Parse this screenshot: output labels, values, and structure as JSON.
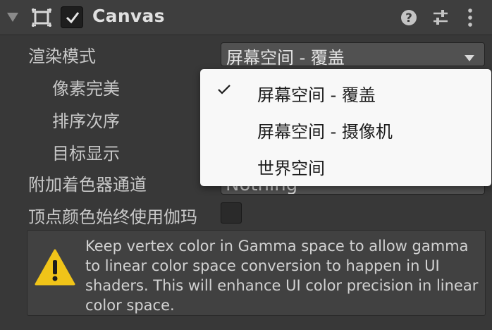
{
  "component": {
    "title": "Canvas",
    "enabled": true,
    "icons": [
      "foldout-triangle-icon",
      "canvas-component-icon",
      "help-icon",
      "preset-icon",
      "kebab-menu-icon"
    ]
  },
  "properties": {
    "render_mode": {
      "label": "渲染模式",
      "value": "屏幕空间 - 覆盖"
    },
    "pixel_perfect": {
      "label": "像素完美"
    },
    "sort_order": {
      "label": "排序次序"
    },
    "target_display": {
      "label": "目标显示"
    },
    "additional_shader_channels": {
      "label": "附加着色器通道",
      "value": "Nothing"
    },
    "vertex_color_gamma": {
      "label": "顶点颜色始终使用伽玛",
      "checked": false
    }
  },
  "helpbox": {
    "icon": "warning-icon",
    "text": "Keep vertex color in Gamma space to allow gamma to linear color space conversion to happen in UI shaders. This will enhance UI color precision in linear color space."
  },
  "dropdown": {
    "options": [
      {
        "label": "屏幕空间 - 覆盖",
        "selected": true
      },
      {
        "label": "屏幕空间 - 摄像机",
        "selected": false
      },
      {
        "label": "世界空间",
        "selected": false
      }
    ]
  },
  "colors": {
    "background": "#383838",
    "field": "#515151",
    "popup": "#f8f8f8",
    "warning": "#f0c419"
  }
}
